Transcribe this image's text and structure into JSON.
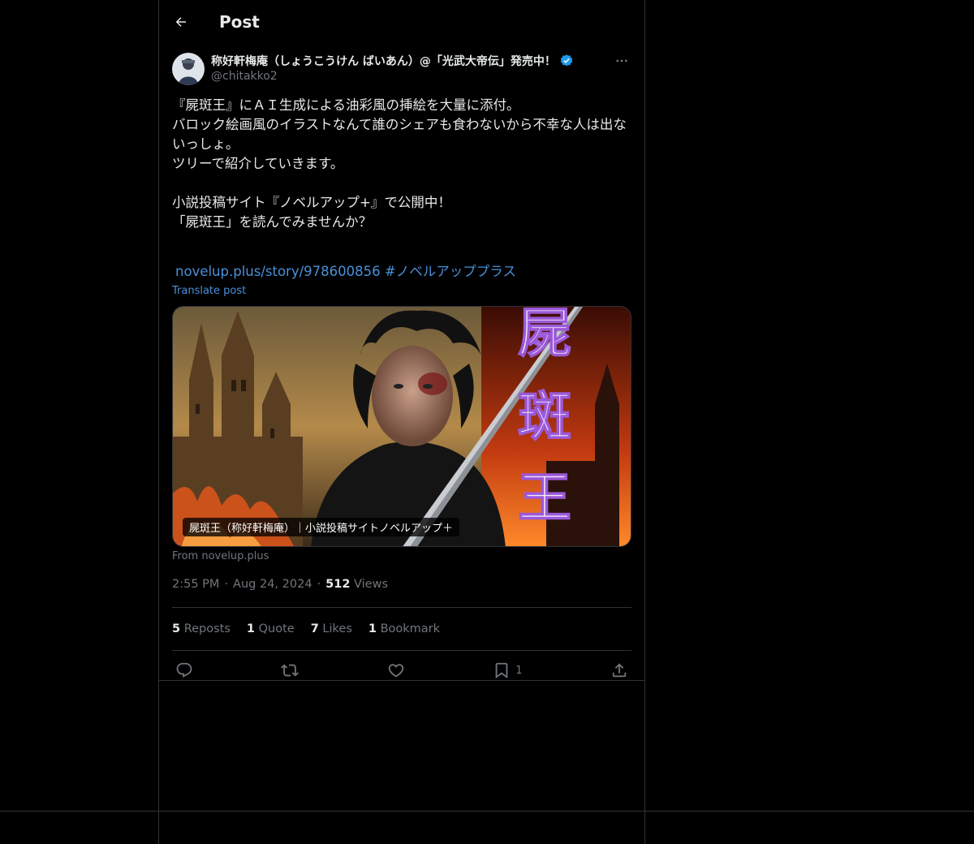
{
  "header": {
    "title": "Post"
  },
  "author": {
    "display_name": "称好軒梅庵（しょうこうけん ばいあん）@「光武大帝伝」発売中！",
    "handle": "@chitakko2"
  },
  "tweet": {
    "text": "『屍斑王』にＡＩ生成による油彩風の挿絵を大量に添付。\nバロック絵画風のイラストなんて誰のシェアも食わないから不幸な人は出ないっしょ。\nツリーで紹介していきます。\n\n小説投稿サイト『ノベルアップ+』で公開中！\n「屍斑王」を読んでみませんか？",
    "link_text": "novelup.plus/story/978600856",
    "hashtag": "#ノベルアッププラス",
    "translate_label": "Translate post"
  },
  "card": {
    "caption": "屍斑王（称好軒梅庵）｜小説投稿サイトノベルアップ＋",
    "source": "From novelup.plus",
    "title_glyphs": [
      "屍",
      "斑",
      "王"
    ]
  },
  "meta": {
    "time": "2:55 PM",
    "date": "Aug 24, 2024",
    "views_count": "512",
    "views_label": "Views"
  },
  "stats": {
    "reposts_count": "5",
    "reposts_label": "Reposts",
    "quotes_count": "1",
    "quotes_label": "Quote",
    "likes_count": "7",
    "likes_label": "Likes",
    "bookmarks_count": "1",
    "bookmarks_label": "Bookmark"
  },
  "actions": {
    "bookmark_count": "1"
  },
  "colors": {
    "background": "#000000",
    "text": "#e7e9ea",
    "muted": "#71767b",
    "link": "#4a90d9",
    "border": "#2f3336",
    "verified": "#1d9bf0"
  }
}
